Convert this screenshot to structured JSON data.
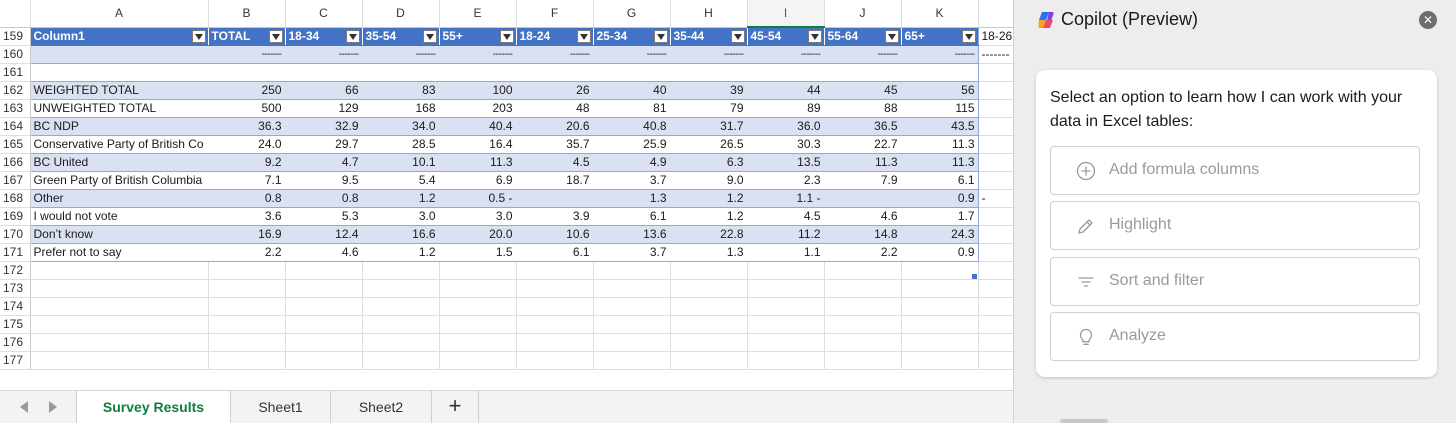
{
  "sheet": {
    "columns": [
      "",
      "A",
      "B",
      "C",
      "D",
      "E",
      "F",
      "G",
      "H",
      "I",
      "J",
      "K",
      ""
    ],
    "selected_column": "I",
    "header_row": {
      "rownum": "159",
      "cells": [
        "Column1",
        "TOTAL",
        "18-34",
        "35-54",
        "55+",
        "18-24",
        "25-34",
        "35-44",
        "45-54",
        "55-64",
        "65+"
      ],
      "outside": "18-26"
    },
    "dash_row": {
      "rownum": "160",
      "dash": "-------",
      "outside": "-------"
    },
    "blank_rownum": "161",
    "data_rows": [
      {
        "rownum": "162",
        "label": "WEIGHTED TOTAL",
        "values": [
          "250",
          "66",
          "83",
          "100",
          "26",
          "40",
          "39",
          "44",
          "45",
          "56"
        ],
        "outside": ""
      },
      {
        "rownum": "163",
        "label": "UNWEIGHTED TOTAL",
        "values": [
          "500",
          "129",
          "168",
          "203",
          "48",
          "81",
          "79",
          "89",
          "88",
          "115"
        ],
        "outside": ""
      },
      {
        "rownum": "164",
        "label": "BC NDP",
        "values": [
          "36.3",
          "32.9",
          "34.0",
          "40.4",
          "20.6",
          "40.8",
          "31.7",
          "36.0",
          "36.5",
          "43.5"
        ],
        "outside": ""
      },
      {
        "rownum": "165",
        "label": "Conservative Party of British Co",
        "values": [
          "24.0",
          "29.7",
          "28.5",
          "16.4",
          "35.7",
          "25.9",
          "26.5",
          "30.3",
          "22.7",
          "11.3"
        ],
        "outside": ""
      },
      {
        "rownum": "166",
        "label": "BC United",
        "values": [
          "9.2",
          "4.7",
          "10.1",
          "11.3",
          "4.5",
          "4.9",
          "6.3",
          "13.5",
          "11.3",
          "11.3"
        ],
        "outside": ""
      },
      {
        "rownum": "167",
        "label": "Green Party of British Columbia",
        "values": [
          "7.1",
          "9.5",
          "5.4",
          "6.9",
          "18.7",
          "3.7",
          "9.0",
          "2.3",
          "7.9",
          "6.1"
        ],
        "outside": ""
      },
      {
        "rownum": "168",
        "label": "Other",
        "values": [
          "0.8",
          "0.8",
          "1.2",
          "0.5 -",
          "",
          "1.3",
          "1.2",
          "1.1 -",
          "",
          "0.9"
        ],
        "outside": "-"
      },
      {
        "rownum": "169",
        "label": "I would not vote",
        "values": [
          "3.6",
          "5.3",
          "3.0",
          "3.0",
          "3.9",
          "6.1",
          "1.2",
          "4.5",
          "4.6",
          "1.7"
        ],
        "outside": ""
      },
      {
        "rownum": "170",
        "label": "Don’t know",
        "values": [
          "16.9",
          "12.4",
          "16.6",
          "20.0",
          "10.6",
          "13.6",
          "22.8",
          "11.2",
          "14.8",
          "24.3"
        ],
        "outside": ""
      },
      {
        "rownum": "171",
        "label": "Prefer not to say",
        "values": [
          "2.2",
          "4.6",
          "1.2",
          "1.5",
          "6.1",
          "3.7",
          "1.3",
          "1.1",
          "2.2",
          "0.9"
        ],
        "outside": ""
      }
    ],
    "empty_rownums": [
      "172",
      "173",
      "174",
      "175",
      "176",
      "177"
    ]
  },
  "tabs": {
    "sheets": [
      "Survey Results",
      "Sheet1",
      "Sheet2"
    ],
    "active_index": 0,
    "add_label": "+"
  },
  "copilot": {
    "title": "Copilot (Preview)",
    "close_label": "✕",
    "prompt": "Select an option to learn how I can work with your data in Excel tables:",
    "options": [
      {
        "label": "Add formula columns",
        "icon": "plus-circle-icon"
      },
      {
        "label": "Highlight",
        "icon": "pen-icon"
      },
      {
        "label": "Sort and filter",
        "icon": "filter-lines-icon"
      },
      {
        "label": "Analyze",
        "icon": "lightbulb-icon"
      }
    ]
  },
  "colors": {
    "table_header": "#4472c4",
    "band": "#d9e1f2",
    "excel_green": "#107c41"
  }
}
